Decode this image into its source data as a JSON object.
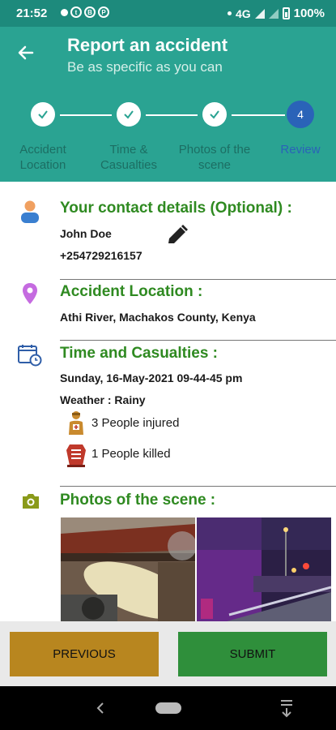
{
  "status": {
    "time": "21:52",
    "network": "4G",
    "battery": "100%"
  },
  "header": {
    "title": "Report an accident",
    "subtitle": "Be as specific as you can"
  },
  "steps": [
    {
      "label": "Accident Location",
      "state": "done"
    },
    {
      "label": "Time & Casualties",
      "state": "done"
    },
    {
      "label": "Photos of the scene",
      "state": "done"
    },
    {
      "label": "Review",
      "number": "4",
      "state": "active"
    }
  ],
  "contact": {
    "title": "Your contact details (Optional) :",
    "name": "John Doe",
    "phone": "+254729216157"
  },
  "location": {
    "title": "Accident Location :",
    "value": "Athi River, Machakos County, Kenya"
  },
  "time_casualties": {
    "title": "Time and Casualties :",
    "datetime": "Sunday, 16-May-2021 09-44-45 pm",
    "weather": "Weather : Rainy",
    "injured": "3 People injured",
    "killed": "1 People killed"
  },
  "photos": {
    "title": "Photos of the scene :"
  },
  "buttons": {
    "previous": "PREVIOUS",
    "submit": "SUBMIT"
  },
  "colors": {
    "header": "#2aa392",
    "statusbar": "#1d8a7c",
    "section_title": "#2f8a21",
    "step_active": "#2a63b8",
    "previous_button": "#b8861f",
    "submit_button": "#2f8f3b"
  }
}
